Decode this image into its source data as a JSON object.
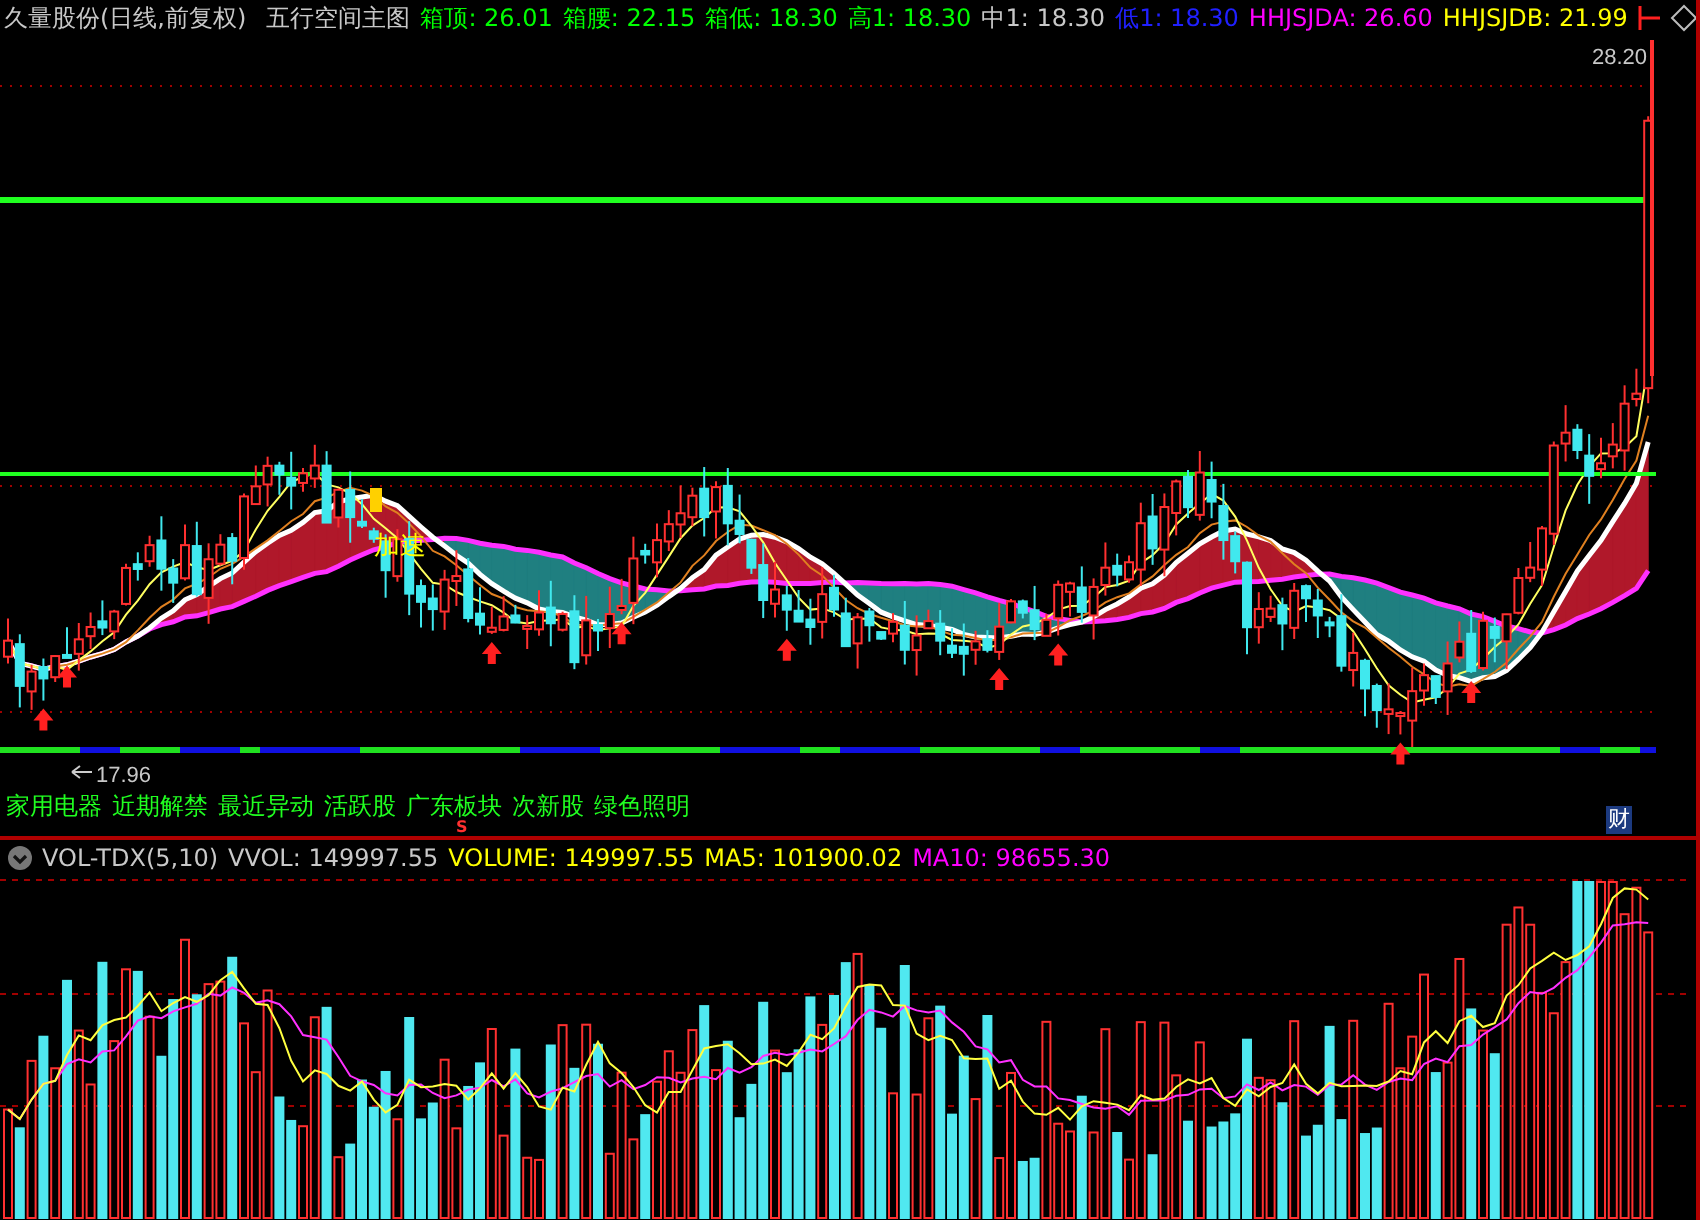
{
  "header": {
    "stock": "久量股份(日线,前复权)",
    "indicator": "五行空间主图",
    "readings": [
      {
        "text": "箱顶: 26.01",
        "color": "#00ff00"
      },
      {
        "text": "箱腰: 22.15",
        "color": "#00ff00"
      },
      {
        "text": "箱低: 18.30",
        "color": "#00ff00"
      },
      {
        "text": "高1: 18.30",
        "color": "#00ff00"
      },
      {
        "text": "中1: 18.30",
        "color": "#c8c8c8"
      },
      {
        "text": "低1: 18.30",
        "color": "#2020ff"
      },
      {
        "text": "HHJSJDA: 26.60",
        "color": "#ff00ff"
      },
      {
        "text": "HHJSJDB: 21.99",
        "color": "#ffff00"
      }
    ]
  },
  "price_chart": {
    "high_label": "28.20",
    "low_label": "17.96",
    "annotation": "加速"
  },
  "concepts": [
    "家用电器",
    "近期解禁",
    "最近异动",
    "活跃股",
    "广东板块",
    "次新股",
    "绿色照明"
  ],
  "signal_mark": "S",
  "finance_badge": "财",
  "volume": {
    "indicator": "VOL-TDX(5,10)",
    "readings": [
      {
        "text": "VVOL: 149997.55",
        "color": "#c8c8c8"
      },
      {
        "text": "VOLUME: 149997.55",
        "color": "#ffff00"
      },
      {
        "text": "MA5: 101900.02",
        "color": "#ffff00"
      },
      {
        "text": "MA10: 98655.30",
        "color": "#ff00ff"
      }
    ]
  }
}
